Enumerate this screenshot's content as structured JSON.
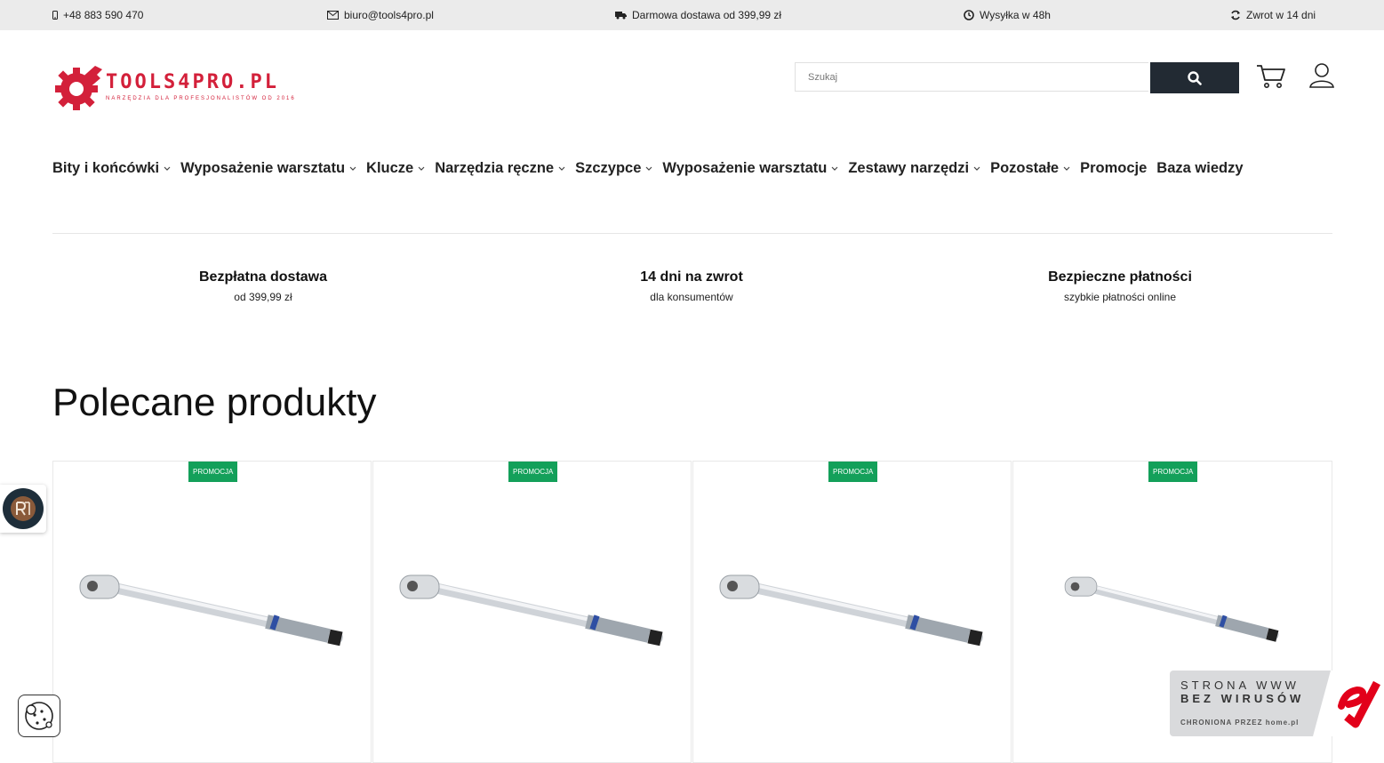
{
  "topbar": {
    "phone": "+48 883 590 470",
    "email": "biuro@tools4pro.pl",
    "delivery": "Darmowa dostawa od 399,99 zł",
    "shipping": "Wysyłka w 48h",
    "returns": "Zwrot w 14 dni"
  },
  "header": {
    "logo_text": "TOOLS4PRO.PL",
    "logo_sub": "NARZĘDZIA DLA PROFESJONALISTÓW OD 2016",
    "search_placeholder": "Szukaj"
  },
  "nav": {
    "items": [
      {
        "label": "Bity i końcówki"
      },
      {
        "label": "Wyposażenie warsztatu"
      },
      {
        "label": "Klucze"
      },
      {
        "label": "Narzędzia ręczne"
      },
      {
        "label": "Szczypce"
      },
      {
        "label": "Wyposażenie warsztatu"
      },
      {
        "label": "Zestawy narzędzi"
      },
      {
        "label": "Pozostałe"
      },
      {
        "label": "Promocje"
      },
      {
        "label": "Baza wiedzy"
      }
    ]
  },
  "features": [
    {
      "title": "Bezpłatna dostawa",
      "subtitle": "od 399,99 zł"
    },
    {
      "title": "14 dni na zwrot",
      "subtitle": "dla konsumentów"
    },
    {
      "title": "Bezpieczne płatności",
      "subtitle": "szybkie płatności online"
    }
  ],
  "section": {
    "title": "Polecane produkty"
  },
  "products": [
    {
      "badge": "PROMOCJA"
    },
    {
      "badge": "PROMOCJA"
    },
    {
      "badge": "PROMOCJA"
    },
    {
      "badge": "PROMOCJA"
    }
  ],
  "virus_badge": {
    "line1": "STRONA WWW",
    "line2": "BEZ WIRUSÓW",
    "line3": "CHRONIONA PRZEZ home.pl"
  },
  "colors": {
    "brand": "#d3203a",
    "promo": "#13a05a",
    "search_button": "#222a33"
  }
}
